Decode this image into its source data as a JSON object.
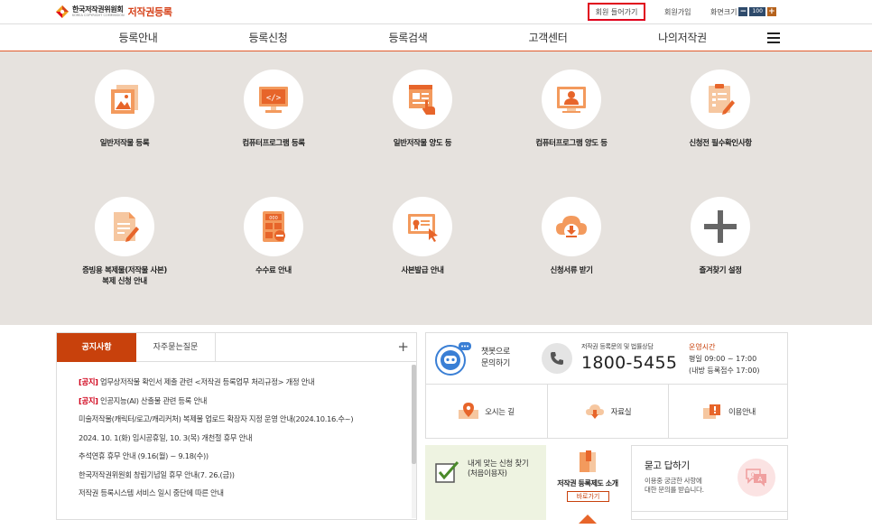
{
  "header": {
    "logo_org_ko": "한국저작권위원회",
    "logo_org_en": "KOREA COPYRIGHT COMMISSION",
    "logo_service": "저작권등록",
    "login_label": "회원 들어가기",
    "join_label": "회원가입",
    "zoom_label": "화면크기",
    "zoom_minus": "−",
    "zoom_value": "100",
    "zoom_plus": "+"
  },
  "gnb": {
    "items": [
      "등록안내",
      "등록신청",
      "등록검색",
      "고객센터",
      "나의저작권"
    ]
  },
  "quick_menu": {
    "items": [
      {
        "label": "일반저작물 등록",
        "icon": "image-document-icon"
      },
      {
        "label": "컴퓨터프로그램 등록",
        "icon": "code-monitor-icon"
      },
      {
        "label": "일반저작물 양도 등",
        "icon": "document-hand-icon"
      },
      {
        "label": "컴퓨터프로그램 양도 등",
        "icon": "user-card-icon"
      },
      {
        "label": "신청전 필수확인사항",
        "icon": "checklist-pen-icon"
      },
      {
        "label": "증빙용 복제물(저작물 사본)",
        "label2": "복제 신청 안내",
        "icon": "document-pen-icon"
      },
      {
        "label": "수수료 안내",
        "icon": "calculator-icon"
      },
      {
        "label": "사본발급 안내",
        "icon": "certificate-cursor-icon"
      },
      {
        "label": "신청서류 받기",
        "icon": "cloud-download-icon"
      },
      {
        "label": "즐겨찾기 설정",
        "icon": "plus-icon"
      }
    ]
  },
  "notice": {
    "tab_notice": "공지사항",
    "tab_faq": "자주묻는질문",
    "more": "+",
    "items": [
      {
        "tag": "[공지]",
        "text": " 업무상저작물 확인서 제출 관련 <저작권 등록업무 처리규정> 개정 안내"
      },
      {
        "tag": "[공지]",
        "text": " 인공지능(AI) 산출물 관련 등록 안내"
      },
      {
        "tag": "",
        "text": "미술저작물(캐릭터/로고/캐리커처) 복제물 업로드 확장자 지정 운영 안내(2024.10.16.수~)"
      },
      {
        "tag": "",
        "text": "2024. 10. 1(화) 임시공휴일, 10. 3(목) 개천절 휴무 안내"
      },
      {
        "tag": "",
        "text": "추석연휴 휴무 안내 (9.16(월) ~ 9.18(수))"
      },
      {
        "tag": "",
        "text": "한국저작권위원회 창립기념일 휴무 안내(7. 26.(금))"
      },
      {
        "tag": "",
        "text": "저작권 등록시스템 서비스 일시 중단에 따른 안내"
      }
    ]
  },
  "contact": {
    "chatbot_line1": "챗봇으로",
    "chatbot_line2": "문의하기",
    "phone_sub": "저작권 등록문의 및 법률상담",
    "phone_number": "1800-5455",
    "hours_title": "운영시간",
    "hours_line1": "평일 09:00 ~ 17:00",
    "hours_line2": "(내방 등록접수 17:00)"
  },
  "links": {
    "directions": "오시는 길",
    "archive": "자료실",
    "guide": "이용안내"
  },
  "bottom": {
    "find_line1": "내게 맞는 신청 찾기",
    "find_line2": "(처음이용자)",
    "intro_title": "저작권 등록제도 소개",
    "intro_button": "바로가기",
    "qa_title": "묻고 답하기",
    "qa_desc1": "이용중 궁금한 사항에",
    "qa_desc2": "대한 문의를 받습니다."
  },
  "colors": {
    "accent": "#c8410c",
    "notice_tag": "#d0021b",
    "quick_bg": "#e6e2de",
    "login_border": "#e0001b"
  }
}
